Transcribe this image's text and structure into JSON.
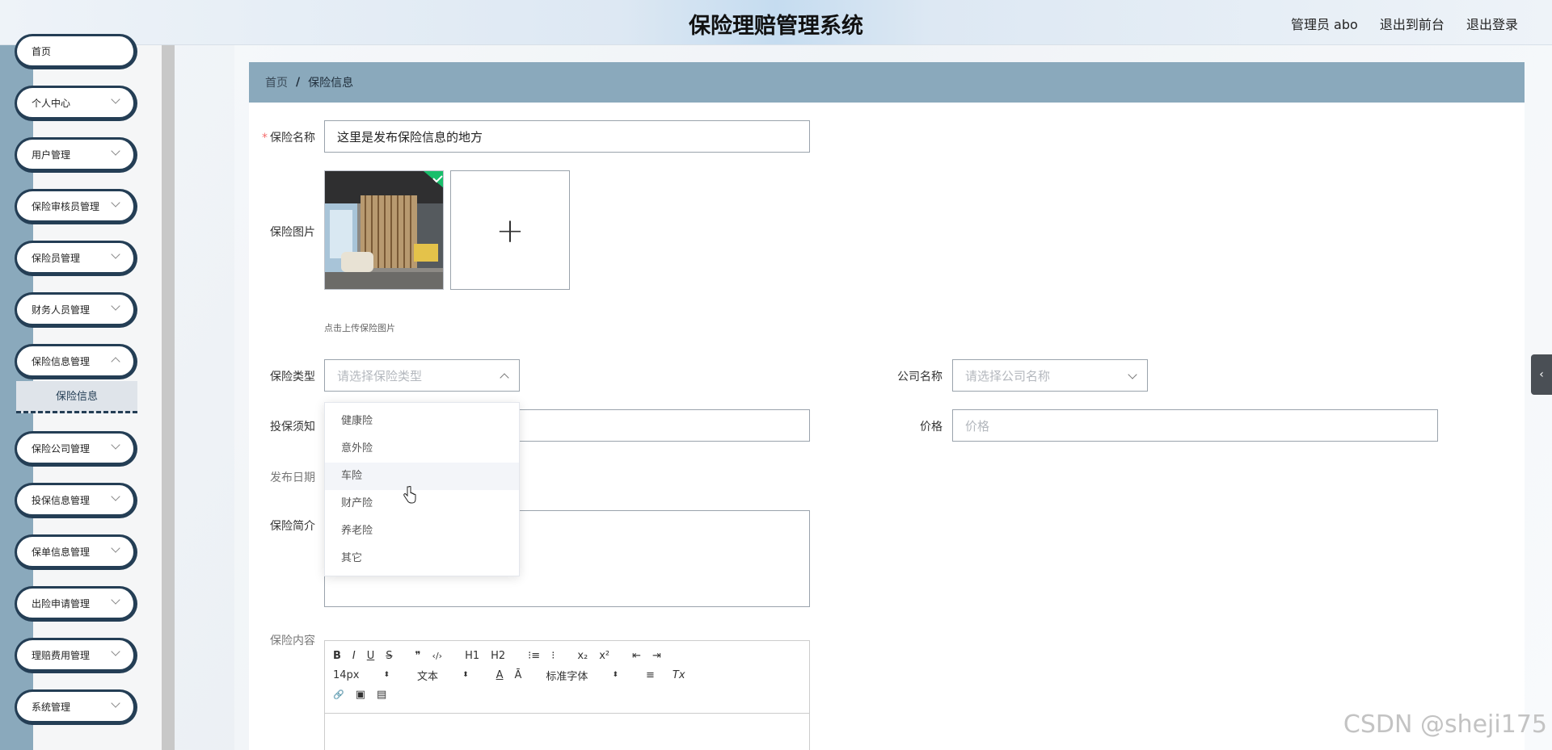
{
  "header": {
    "title": "保险理赔管理系统",
    "admin": "管理员 abo",
    "exit_front": "退出到前台",
    "logout": "退出登录"
  },
  "sidebar": {
    "items": [
      {
        "label": "首页"
      },
      {
        "label": "个人中心"
      },
      {
        "label": "用户管理"
      },
      {
        "label": "保险审核员管理"
      },
      {
        "label": "保险员管理"
      },
      {
        "label": "财务人员管理"
      },
      {
        "label": "保险信息管理"
      },
      {
        "label": "保险公司管理"
      },
      {
        "label": "投保信息管理"
      },
      {
        "label": "保单信息管理"
      },
      {
        "label": "出险申请管理"
      },
      {
        "label": "理赔费用管理"
      },
      {
        "label": "系统管理"
      }
    ],
    "active_sub": "保险信息"
  },
  "breadcrumb": {
    "home": "首页",
    "sep": "/",
    "current": "保险信息"
  },
  "form": {
    "name_label": "保险名称",
    "name_required": "*",
    "name_value": "这里是发布保险信息的地方",
    "image_label": "保险图片",
    "image_add": "+",
    "image_tip": "点击上传保险图片",
    "type_label": "保险类型",
    "type_placeholder": "请选择保险类型",
    "company_label": "公司名称",
    "company_placeholder": "请选择公司名称",
    "notice_label": "投保须知",
    "price_label": "价格",
    "price_placeholder": "价格",
    "date_label": "发布日期",
    "intro_label": "保险简介",
    "content_label": "保险内容"
  },
  "dropdown": {
    "options": [
      "健康险",
      "意外险",
      "车险",
      "财产险",
      "养老险",
      "其它"
    ],
    "hovered": "车险"
  },
  "editor": {
    "row1": [
      "B",
      "I",
      "U",
      "S",
      "❞",
      "‹/›",
      "H1",
      "H2",
      "⁝≡",
      "⁝",
      "x₂",
      "x²",
      "⇤",
      "⇥"
    ],
    "font_size": "14px",
    "text_style": "文本",
    "font_family": "标准字体",
    "row2_icons": [
      "A",
      "Ā",
      "≡",
      "Tx"
    ],
    "row3": [
      "🔗",
      "▣",
      "▤"
    ]
  },
  "watermark": "CSDN @sheji175",
  "colors": {
    "accent": "#8aa9bc",
    "sidebar_border": "#243e55",
    "required": "#f56c6c"
  }
}
